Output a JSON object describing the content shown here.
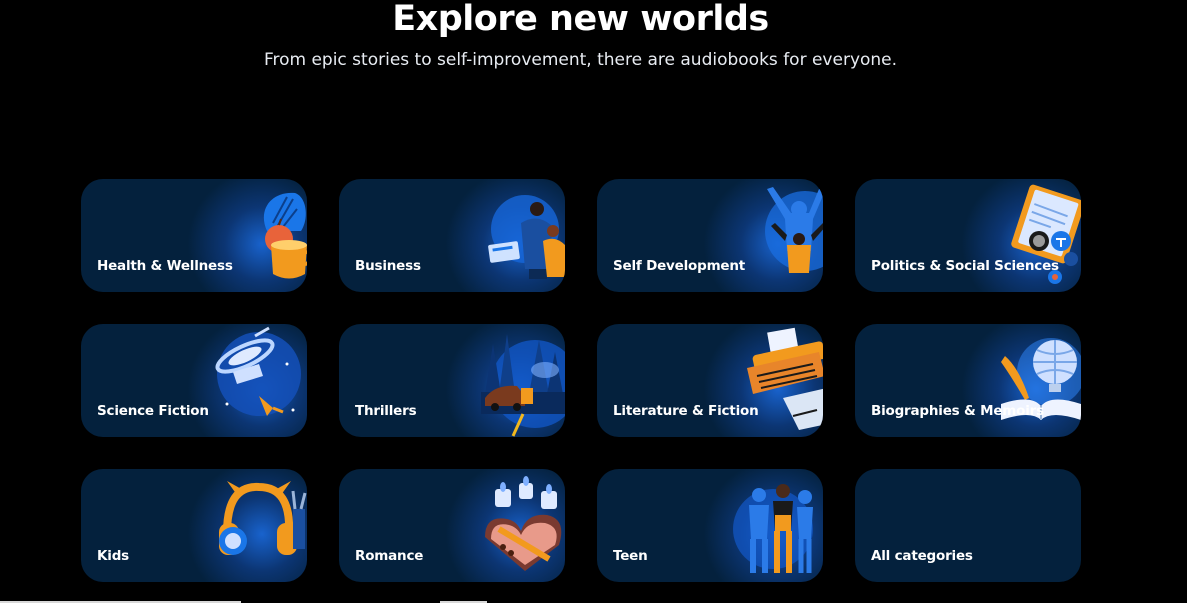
{
  "hero": {
    "title": "Explore new worlds",
    "subtitle": "From epic stories to self-improvement, there are audiobooks for everyone."
  },
  "categories": [
    {
      "label": "Health & Wellness",
      "icon": "tea-apple-icon"
    },
    {
      "label": "Business",
      "icon": "business-people-icon"
    },
    {
      "label": "Self Development",
      "icon": "celebrating-person-icon"
    },
    {
      "label": "Politics & Social Sciences",
      "icon": "clipboard-badges-icon"
    },
    {
      "label": "Science Fiction",
      "icon": "satellite-icon"
    },
    {
      "label": "Thrillers",
      "icon": "car-forest-icon"
    },
    {
      "label": "Literature & Fiction",
      "icon": "typewriter-icon"
    },
    {
      "label": "Biographies & Memoirs",
      "icon": "globe-quill-icon"
    },
    {
      "label": "Kids",
      "icon": "headphones-icon"
    },
    {
      "label": "Romance",
      "icon": "candles-heart-box-icon"
    },
    {
      "label": "Teen",
      "icon": "teen-group-icon"
    },
    {
      "label": "All categories",
      "icon": ""
    }
  ],
  "colors": {
    "background": "#000000",
    "card": "#04213d",
    "accent_blue": "#1c6ee6",
    "accent_orange": "#f39a1e"
  }
}
